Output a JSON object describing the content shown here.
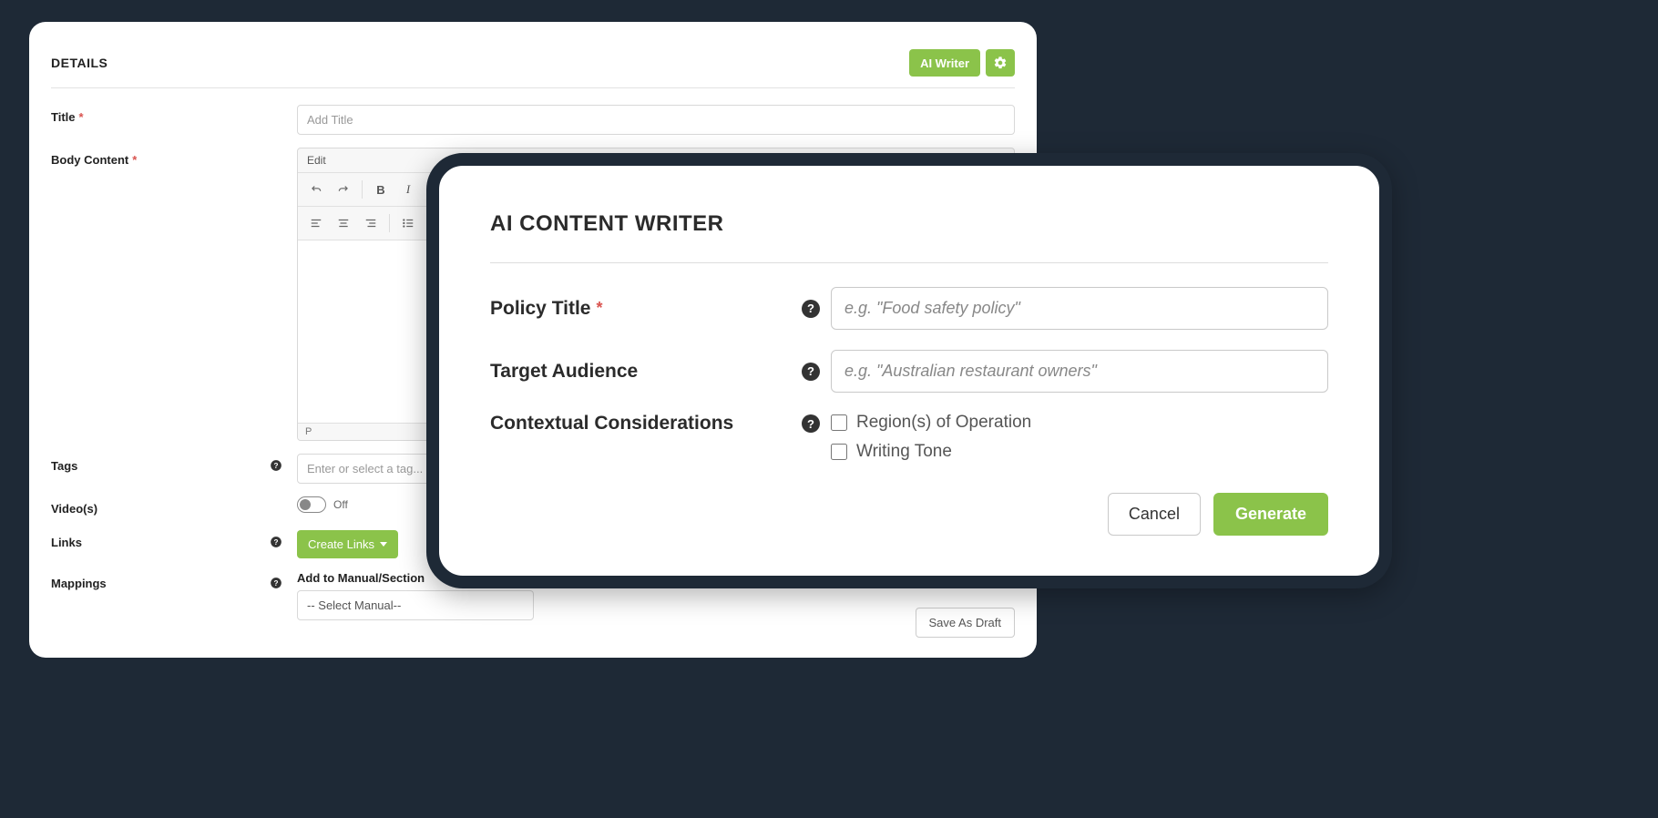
{
  "details": {
    "section_title": "DETAILS",
    "ai_writer_button": "AI Writer",
    "fields": {
      "title": {
        "label": "Title",
        "placeholder": "Add Title"
      },
      "body_content": {
        "label": "Body Content"
      },
      "tags": {
        "label": "Tags",
        "placeholder": "Enter or select a tag..."
      },
      "videos": {
        "label": "Video(s)",
        "toggle_state": "Off"
      },
      "links": {
        "label": "Links",
        "button": "Create Links"
      },
      "mappings": {
        "label": "Mappings",
        "sublabel": "Add to Manual/Section",
        "select_placeholder": "-- Select Manual--"
      }
    },
    "editor": {
      "menu_item": "Edit",
      "status_path": "P"
    },
    "save_draft": "Save As Draft"
  },
  "ai_modal": {
    "title": "AI CONTENT WRITER",
    "policy_title": {
      "label": "Policy Title",
      "placeholder": "e.g. \"Food safety policy\""
    },
    "target_audience": {
      "label": "Target Audience",
      "placeholder": "e.g. \"Australian restaurant owners\""
    },
    "contextual": {
      "label": "Contextual Considerations",
      "options": {
        "regions": "Region(s) of Operation",
        "tone": "Writing Tone"
      }
    },
    "cancel": "Cancel",
    "generate": "Generate"
  }
}
